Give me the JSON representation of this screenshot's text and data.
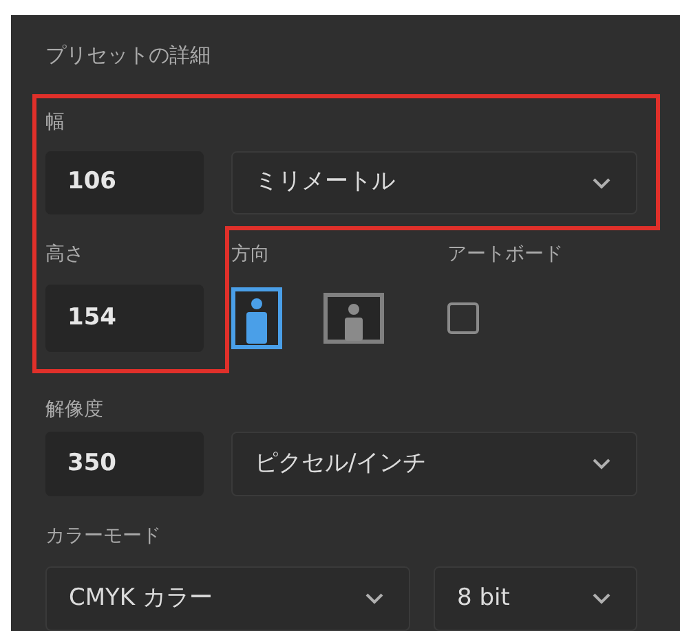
{
  "panel": {
    "title": "プリセットの詳細"
  },
  "width": {
    "label": "幅",
    "value": "106",
    "unit": "ミリメートル"
  },
  "height": {
    "label": "高さ",
    "value": "154"
  },
  "orientation": {
    "label": "方向",
    "options": [
      {
        "kind": "portrait",
        "selected": true
      },
      {
        "kind": "landscape",
        "selected": false
      }
    ]
  },
  "artboard": {
    "label": "アートボード",
    "checked": false
  },
  "resolution": {
    "label": "解像度",
    "value": "350",
    "unit": "ピクセル/インチ"
  },
  "color_mode": {
    "label": "カラーモード",
    "mode": "CMYK カラー",
    "depth": "8 bit"
  }
}
